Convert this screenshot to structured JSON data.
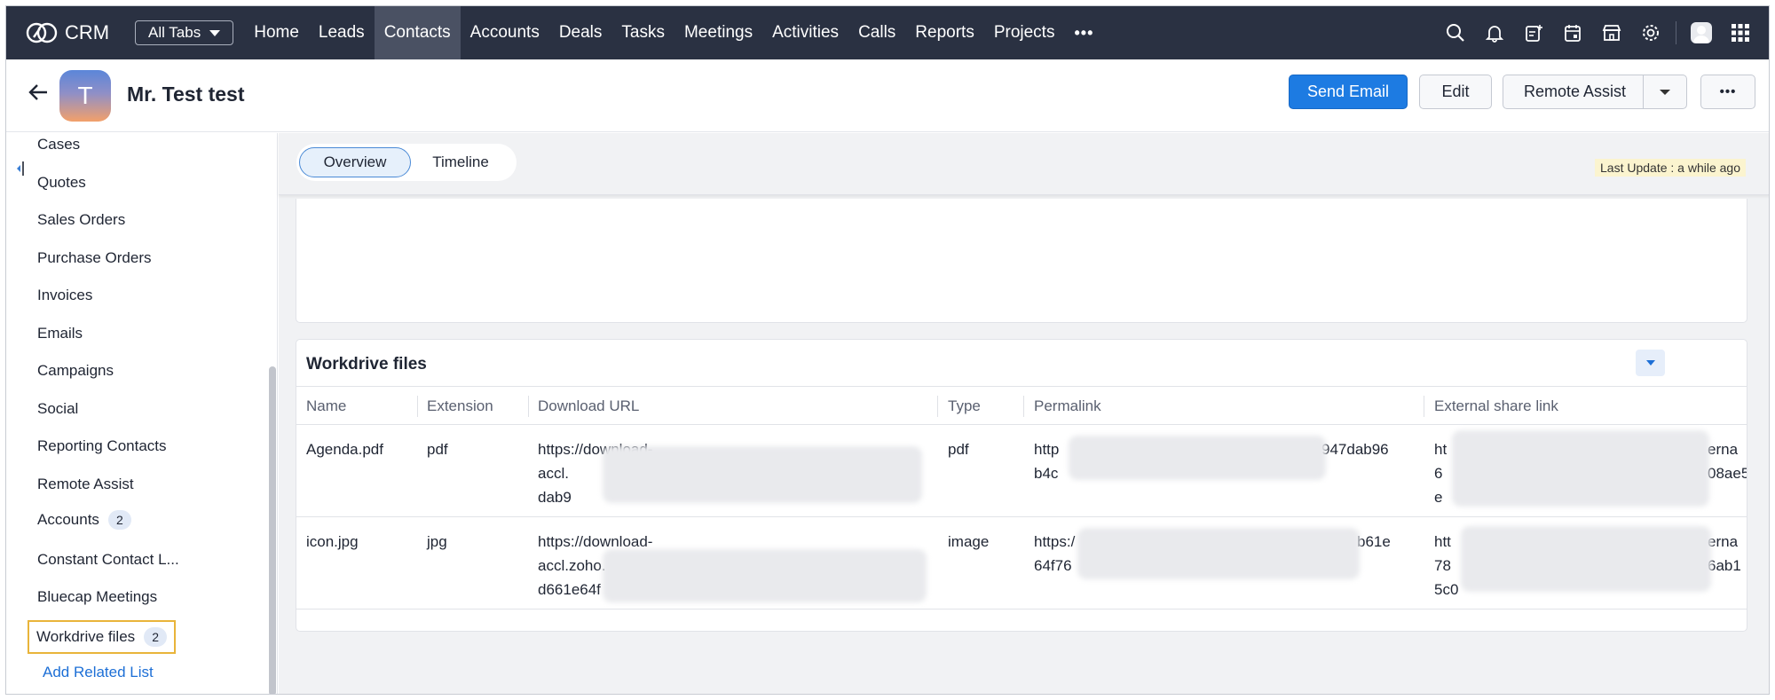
{
  "app": {
    "name": "CRM",
    "all_tabs_label": "All Tabs"
  },
  "nav": {
    "tabs": [
      "Home",
      "Leads",
      "Contacts",
      "Accounts",
      "Deals",
      "Tasks",
      "Meetings",
      "Activities",
      "Calls",
      "Reports",
      "Projects"
    ],
    "active_tab": "Contacts",
    "more_label": "•••",
    "icons": [
      "search-icon",
      "bell-icon",
      "add-note-icon",
      "calendar-icon",
      "marketplace-icon",
      "settings-icon",
      "profile-avatar-icon",
      "apps-grid-icon"
    ]
  },
  "record": {
    "avatar_initial": "T",
    "name": "Mr. Test test",
    "send_email_label": "Send Email",
    "edit_label": "Edit",
    "remote_assist_label": "Remote Assist",
    "more_label": "•••"
  },
  "sidebar": {
    "items": [
      {
        "label": "Cases"
      },
      {
        "label": "Quotes"
      },
      {
        "label": "Sales Orders"
      },
      {
        "label": "Purchase Orders"
      },
      {
        "label": "Invoices"
      },
      {
        "label": "Emails"
      },
      {
        "label": "Campaigns"
      },
      {
        "label": "Social"
      },
      {
        "label": "Reporting Contacts"
      },
      {
        "label": "Remote Assist"
      },
      {
        "label": "Accounts",
        "count": "2"
      },
      {
        "label": "Constant Contact L..."
      },
      {
        "label": "Bluecap Meetings"
      },
      {
        "label": "Workdrive files",
        "count": "2",
        "selected": true
      }
    ],
    "add_related_list_label": "Add Related List"
  },
  "view": {
    "tabs": [
      "Overview",
      "Timeline"
    ],
    "active_tab": "Overview",
    "last_update": "Last Update : a while ago"
  },
  "workdrive": {
    "title": "Workdrive files",
    "columns": [
      "Name",
      "Extension",
      "Download URL",
      "Type",
      "Permalink",
      "External share link"
    ],
    "rows": [
      {
        "name": "Agenda.pdf",
        "extension": "pdf",
        "download_url": [
          "https://download-",
          "accl.",
          "dab9"
        ],
        "type": "pdf",
        "permalink": [
          "http",
          "b4c"
        ],
        "permalink_tail": "947dab96",
        "external": [
          "ht",
          "6",
          "e"
        ],
        "external_tail": [
          "erna",
          "08ae5"
        ]
      },
      {
        "name": "icon.jpg",
        "extension": "jpg",
        "download_url": [
          "https://download-",
          "accl.zoho.",
          "d661e64f"
        ],
        "type": "image",
        "permalink": [
          "https:/",
          "64f76"
        ],
        "permalink_tail": "b61e",
        "external": [
          "htt",
          "78",
          "5c0"
        ],
        "external_tail": [
          "erna",
          "6ab1"
        ]
      }
    ]
  }
}
